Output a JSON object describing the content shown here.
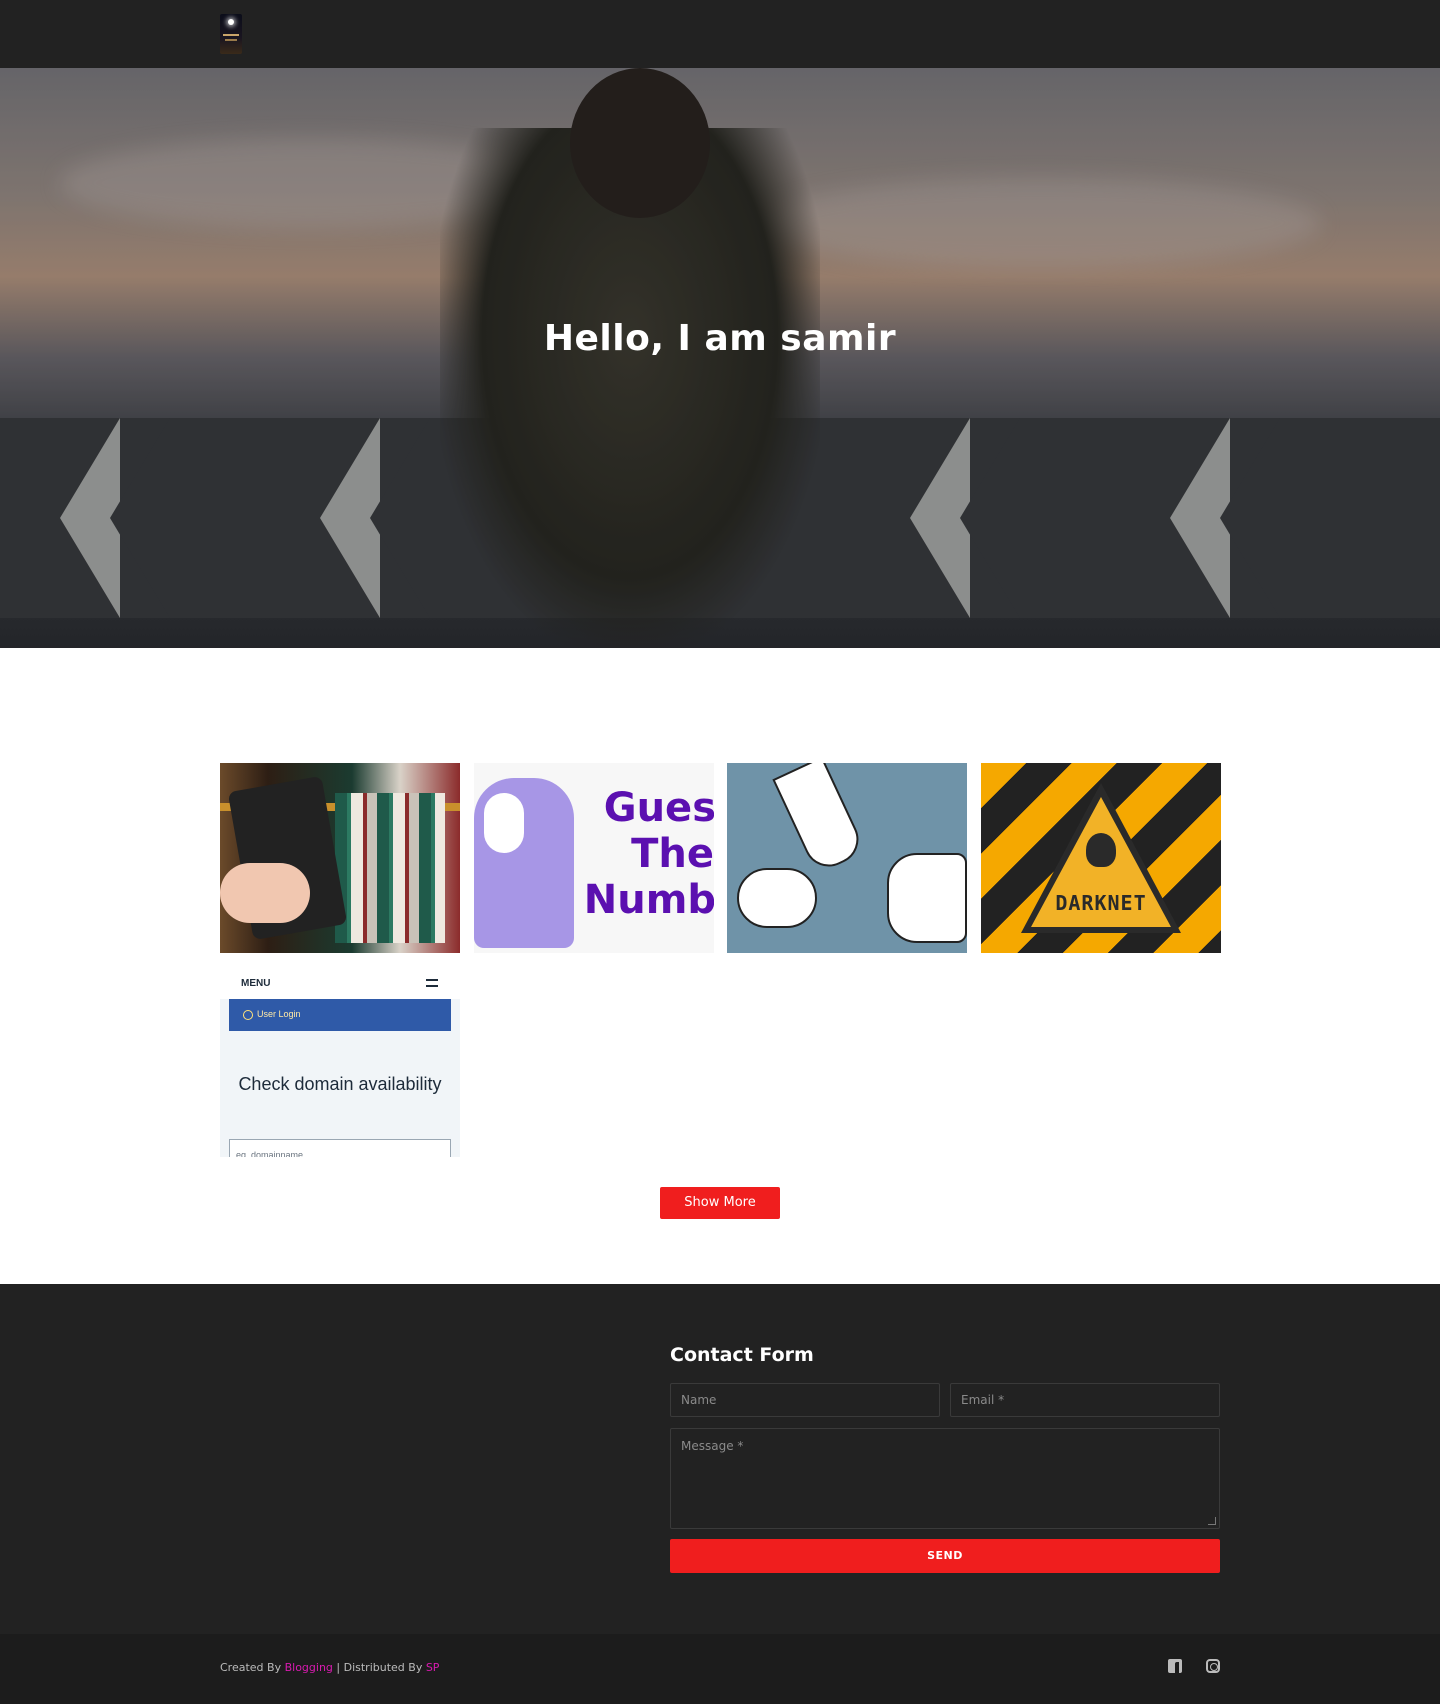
{
  "header": {
    "logo_icon": "site-logo"
  },
  "hero": {
    "title": "Hello, I am samir"
  },
  "portfolio": {
    "items": [
      {
        "name": "library-tablet",
        "icon": "image"
      },
      {
        "name": "guess-the-number",
        "text_line1": "Gues",
        "text_line2": "The",
        "text_line3": "Numb"
      },
      {
        "name": "rock-paper-scissors",
        "icon": "image"
      },
      {
        "name": "darknet",
        "text": "DARKNET"
      },
      {
        "name": "domain-check",
        "menu_label": "MENU",
        "login_label": "User Login",
        "title": "Check domain availability",
        "input_placeholder": "eg. domainname"
      }
    ],
    "show_more_label": "Show More"
  },
  "contact": {
    "title": "Contact Form",
    "name_placeholder": "Name",
    "email_placeholder": "Email *",
    "message_placeholder": "Message *",
    "send_label": "SEND"
  },
  "footer": {
    "created_by_prefix": "Created By ",
    "created_by_link": "Blogging",
    "distributed_prefix": " | Distributed By ",
    "distributed_link": "SP",
    "social_icons": [
      "facebook-icon",
      "instagram-icon"
    ]
  },
  "colors": {
    "accent": "#f01e1e",
    "link": "#d91ab0",
    "dark_bg": "#222222",
    "footer_bg": "#1c1c1c"
  }
}
